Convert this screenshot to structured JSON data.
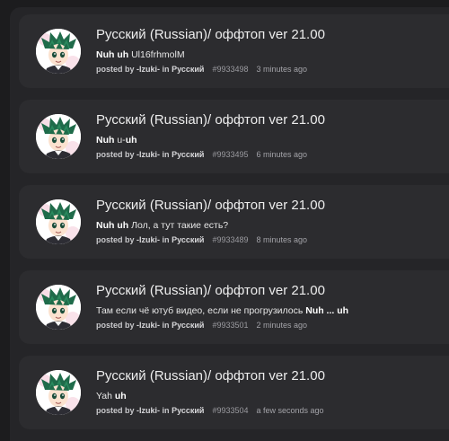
{
  "posts": [
    {
      "title": "Русский (Russian)/ оффтоп ver 21.00",
      "message_bold": "Nuh uh",
      "message_text": " Ul16frhmolM",
      "message_suffix_bold": "",
      "posted_by": "posted by",
      "user": "-Izuki-",
      "in_word": "in",
      "forum": "Русский",
      "post_id": "#9933498",
      "time": "3 minutes ago"
    },
    {
      "title": "Русский (Russian)/ оффтоп ver 21.00",
      "message_bold": "Nuh",
      "message_text": " u-",
      "message_suffix_bold": "uh",
      "posted_by": "posted by",
      "user": "-Izuki-",
      "in_word": "in",
      "forum": "Русский",
      "post_id": "#9933495",
      "time": "6 minutes ago"
    },
    {
      "title": "Русский (Russian)/ оффтоп ver 21.00",
      "message_bold": "Nuh uh",
      "message_text": " Лол, а тут такие есть?",
      "message_suffix_bold": "",
      "posted_by": "posted by",
      "user": "-Izuki-",
      "in_word": "in",
      "forum": "Русский",
      "post_id": "#9933489",
      "time": "8 minutes ago"
    },
    {
      "title": "Русский (Russian)/ оффтоп ver 21.00",
      "message_bold": "",
      "message_text": "Там если чё ютуб видео, если не прогрузилось ",
      "message_suffix_bold": "Nuh ... uh",
      "posted_by": "posted by",
      "user": "-Izuki-",
      "in_word": "in",
      "forum": "Русский",
      "post_id": "#9933501",
      "time": "2 minutes ago"
    },
    {
      "title": "Русский (Russian)/ оффтоп ver 21.00",
      "message_bold": "",
      "message_text": "Yah ",
      "message_suffix_bold": "uh",
      "posted_by": "posted by",
      "user": "-Izuki-",
      "in_word": "in",
      "forum": "Русский",
      "post_id": "#9933504",
      "time": "a few seconds ago"
    }
  ],
  "colors": {
    "page_background": "#1c1c1e",
    "panel_background": "#252528",
    "card_background": "#2c2c2f",
    "avatar_hair": "#1f6b4a",
    "avatar_bg": "#ffffff"
  },
  "avatar_icon": "anime-boy-avatar-icon"
}
